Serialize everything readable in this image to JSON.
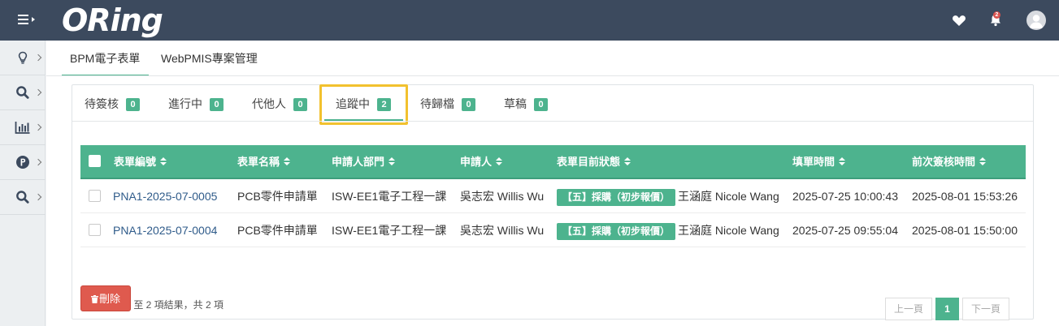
{
  "header": {
    "logo": "ORing",
    "notification_count": "2",
    "icons": [
      "menu-icon",
      "heart-icon",
      "bell-icon",
      "user-icon"
    ]
  },
  "sidebar": {
    "items": [
      {
        "icon": "lightbulb-icon"
      },
      {
        "icon": "search-icon"
      },
      {
        "icon": "bar-chart-icon"
      },
      {
        "icon": "p-circle-icon"
      },
      {
        "icon": "search-icon"
      }
    ]
  },
  "module_tabs": [
    {
      "label": "BPM電子表單",
      "active": true
    },
    {
      "label": "WebPMIS專案管理",
      "active": false
    }
  ],
  "sub_tabs": [
    {
      "label": "待簽核",
      "count": "0"
    },
    {
      "label": "進行中",
      "count": "0"
    },
    {
      "label": "代他人",
      "count": "0"
    },
    {
      "label": "追蹤中",
      "count": "2",
      "active": true
    },
    {
      "label": "待歸檔",
      "count": "0"
    },
    {
      "label": "草稿",
      "count": "0"
    }
  ],
  "table": {
    "columns": [
      "表單編號",
      "表單名稱",
      "申請人部門",
      "申請人",
      "表單目前狀態",
      "填單時間",
      "前次簽核時間"
    ],
    "rows": [
      {
        "form_no": "PNA1-2025-07-0005",
        "form_name": "PCB零件申請單",
        "department": "ISW-EE1電子工程一課",
        "applicant": "吳志宏 Willis Wu",
        "status": "【五】採購（初步報價）",
        "handler": "王涵庭 Nicole Wang",
        "filled_at": "2025-07-25 10:00:43",
        "last_signed_at": "2025-08-01 15:53:26"
      },
      {
        "form_no": "PNA1-2025-07-0004",
        "form_name": "PCB零件申請單",
        "department": "ISW-EE1電子工程一課",
        "applicant": "吳志宏 Willis Wu",
        "status": "【五】採購（初步報價）",
        "handler": "王涵庭 Nicole Wang",
        "filled_at": "2025-07-25 09:55:04",
        "last_signed_at": "2025-08-01 15:50:00"
      }
    ]
  },
  "summary": "顯示第 1 至 2 項結果，共 2 項",
  "pagination": {
    "prev": "上一頁",
    "current": "1",
    "next": "下一頁"
  },
  "actions": {
    "delete": "刪除"
  },
  "colors": {
    "accent": "#4db38e",
    "topbar": "#3c4a5e",
    "danger": "#df5a4e",
    "highlight": "#f2c12e"
  }
}
